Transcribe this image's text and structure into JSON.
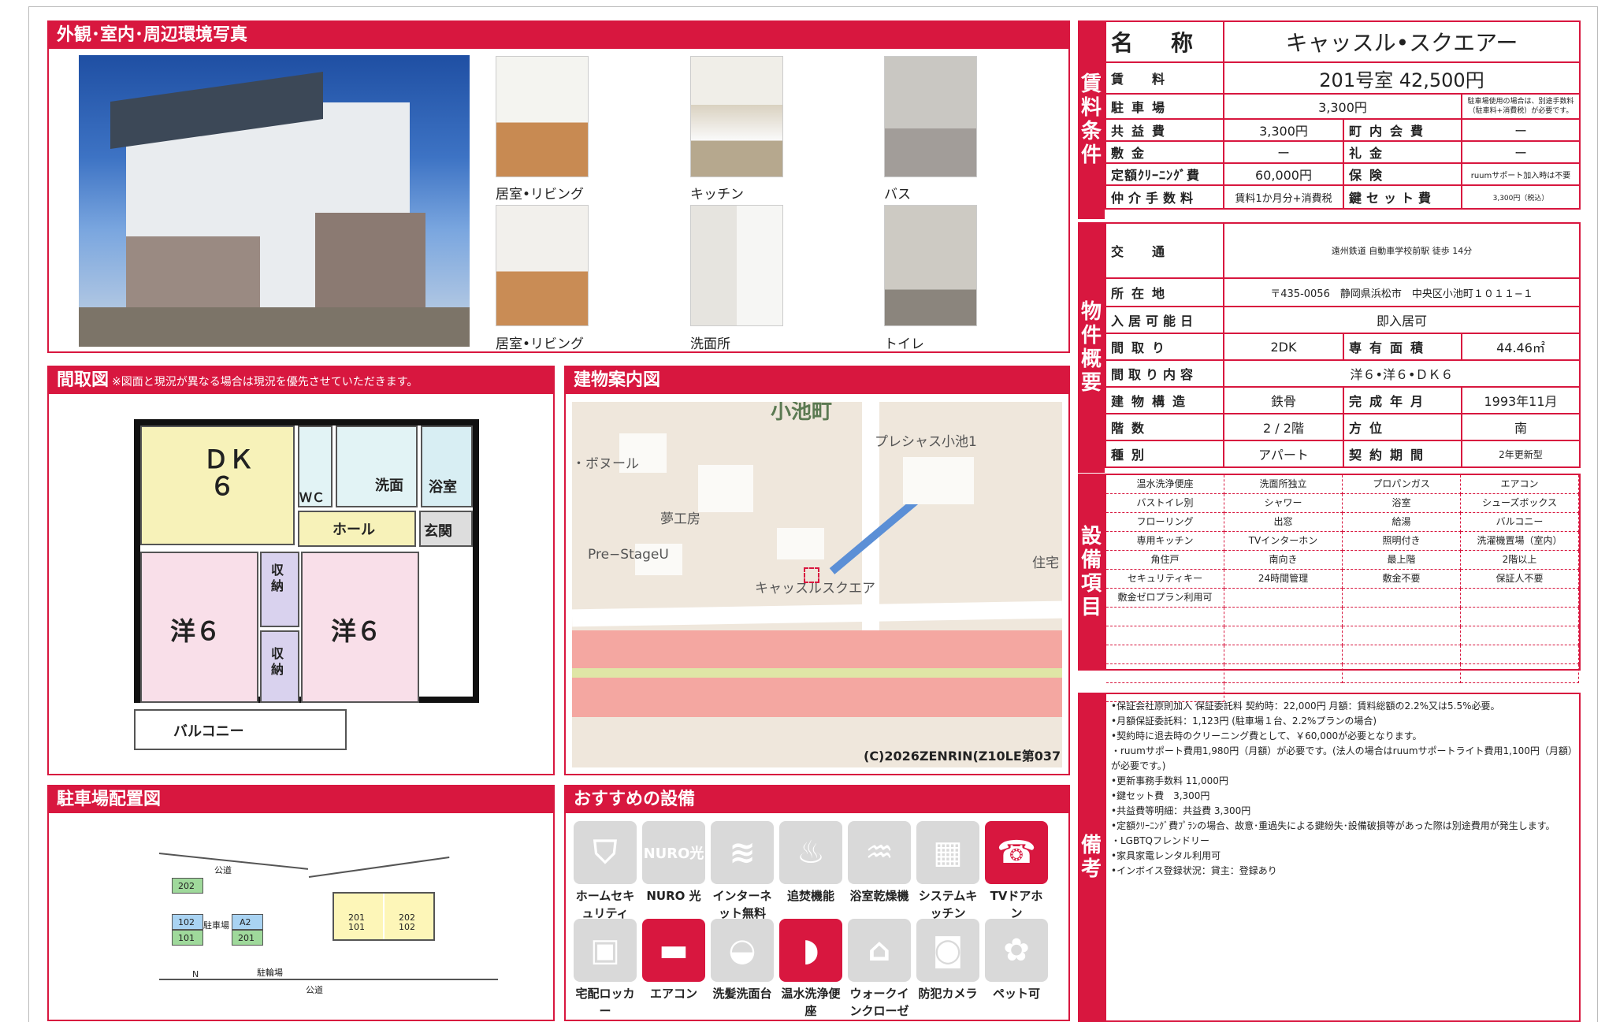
{
  "colors": {
    "accent": "#d8173f",
    "icon_off": "#d9d9d9"
  },
  "photos": {
    "title": "外観･室内･周辺環境写真",
    "captions": [
      "居室•リビング",
      "キッチン",
      "バス",
      "居室•リビング",
      "洗面所",
      "トイレ"
    ]
  },
  "floorplan": {
    "title": "間取図",
    "note": "※図面と現況が異なる場合は現況を優先させていただきます。",
    "rooms": {
      "dk": "ＤＫ",
      "dk_size": "６",
      "wc": "ＷＣ",
      "sink": "洗面",
      "bath": "浴室",
      "hall": "ホール",
      "entrance": "玄関",
      "western1": "洋６",
      "western2": "洋６",
      "storage1": "収納",
      "storage2": "収納",
      "balcony": "バルコニー"
    }
  },
  "map": {
    "title": "建物案内図",
    "labels": [
      "小池町",
      "プレシャス小池1",
      "・ボヌール",
      "夢工房",
      "Pre−StageU",
      "キャッスルスクエア",
      "住宅"
    ],
    "copyright": "(C)2026ZENRIN(Z10LE第037号)"
  },
  "parking": {
    "title": "駐車場配置図",
    "labels": {
      "road_top": "公道",
      "road_bottom": "公道",
      "lot": "駐車場",
      "bike": "駐輪場",
      "north": "N",
      "a2": "A2",
      "s202": "202",
      "s102": "102",
      "s101": "101",
      "s201": "201",
      "b201": "201",
      "b101": "101",
      "b202": "202",
      "b102": "102"
    }
  },
  "recommended": {
    "title": "おすすめの設備",
    "items": [
      {
        "label": "ホームセキュリティ",
        "icon": "shield-icon",
        "on": false
      },
      {
        "label": "NURO 光",
        "icon": "nuro-icon",
        "on": false
      },
      {
        "label": "インターネット無料",
        "icon": "wifi-icon",
        "on": false
      },
      {
        "label": "追焚機能",
        "icon": "bathtub-icon",
        "on": false
      },
      {
        "label": "浴室乾燥機",
        "icon": "dryer-icon",
        "on": false
      },
      {
        "label": "システムキッチン",
        "icon": "kitchen-icon",
        "on": false
      },
      {
        "label": "TVドアホン",
        "icon": "intercom-icon",
        "on": true
      },
      {
        "label": "宅配ロッカー",
        "icon": "locker-icon",
        "on": false
      },
      {
        "label": "エアコン",
        "icon": "aircon-icon",
        "on": true
      },
      {
        "label": "洗髪洗面台",
        "icon": "washbasin-icon",
        "on": false
      },
      {
        "label": "温水洗浄便座",
        "icon": "toilet-icon",
        "on": true
      },
      {
        "label": "ウォークインクローゼット",
        "icon": "closet-icon",
        "on": false
      },
      {
        "label": "防犯カメラ",
        "icon": "camera-icon",
        "on": false
      },
      {
        "label": "ペット可",
        "icon": "paw-icon",
        "on": false
      }
    ]
  },
  "rent": {
    "tab": "賃料条件",
    "name_label": "名　称",
    "name": "キャッスル•スクエアー",
    "rent_label": "賃　料",
    "rent": "201号室 42,500円",
    "parking_label": "駐車場",
    "parking": "3,300円",
    "parking_note": "駐車場使用の場合は、別途手数料（駐車料+消費税）が必要です。",
    "common_label": "共益費",
    "common": "3,300円",
    "town_label": "町内会費",
    "town": "ー",
    "deposit_label": "敷金",
    "deposit": "ー",
    "key_money_label": "礼金",
    "key_money": "ー",
    "cleaning_label": "定額ｸﾘｰﾆﾝｸﾞ費",
    "cleaning": "60,000円",
    "insurance_label": "保険",
    "insurance": "ruumサポート加入時は不要",
    "fee_label": "仲介手数料",
    "fee": "賃料1か月分+消費税",
    "keyset_label": "鍵セット費",
    "keyset": "3,300円（税込）"
  },
  "overview": {
    "tab": "物件概要",
    "access_label": "交　通",
    "access": "遠州鉄道 自動車学校前駅 徒歩 14分",
    "address_label": "所在地",
    "address": "〒435-0056　静岡県浜松市　中央区小池町１０１１−１",
    "movein_label": "入居可能日",
    "movein": "即入居可",
    "layout_label": "間取り",
    "layout": "2DK",
    "area_label": "専有面積",
    "area": "44.46㎡",
    "detail_label": "間取り内容",
    "detail": "洋６•洋６•ＤＫ６",
    "structure_label": "建物構造",
    "structure": "鉄骨",
    "built_label": "完成年月",
    "built": "1993年11月",
    "floor_label": "階数",
    "floor": "2 / 2階",
    "direction_label": "方位",
    "direction": "南",
    "type_label": "種別",
    "type": "アパート",
    "contract_label": "契約期間",
    "contract": "2年更新型"
  },
  "equipment": {
    "tab": "設備項目",
    "items": [
      "温水洗浄便座",
      "洗面所独立",
      "プロパンガス",
      "エアコン",
      "バストイレ別",
      "シャワー",
      "浴室",
      "シューズボックス",
      "フローリング",
      "出窓",
      "給湯",
      "バルコニー",
      "専用キッチン",
      "TVインターホン",
      "照明付き",
      "洗濯機置場（室内）",
      "角住戸",
      "南向き",
      "最上階",
      "2階以上",
      "セキュリティキー",
      "24時間管理",
      "敷金不要",
      "保証人不要",
      "敷金ゼロプラン利用可",
      "",
      "",
      "",
      "",
      "",
      "",
      "",
      "",
      "",
      "",
      "",
      "",
      "",
      "",
      "",
      "",
      "",
      "",
      "",
      ""
    ]
  },
  "remarks": {
    "tab": "備考",
    "lines": [
      "•保証会社原則加入 保証委託料 契約時：22,000円 月額：賃料総額の2.2%又は5.5%必要。",
      "•月額保証委託料：1,123円 (駐車場１台、2.2%プランの場合)",
      "•契約時に退去時のクリーニング費として、￥60,000が必要となります。",
      "・ruumサポート費用1,980円（月額）が必要です。(法人の場合はruumサポートライト費用1,100円（月額）が必要です。)",
      "•更新事務手数料 11,000円",
      "•鍵セット費　3,300円",
      "•共益費等明細：共益費 3,300円",
      "•定額ｸﾘｰﾆﾝｸﾞ費ﾌﾟﾗﾝの場合、故意･重過失による鍵紛失･設備破損等があった際は別途費用が発生します。",
      "・LGBTQフレンドリー",
      "•家具家電レンタル利用可",
      "•インボイス登録状況：貸主：登録あり"
    ]
  }
}
